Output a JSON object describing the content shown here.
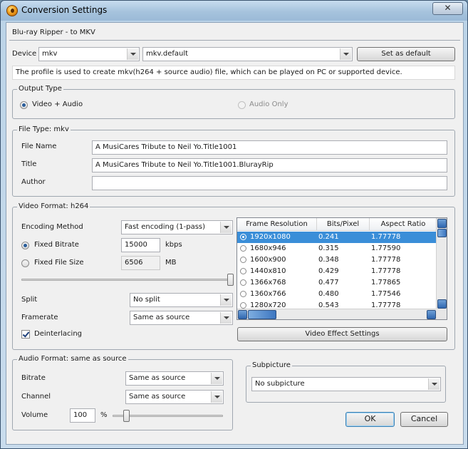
{
  "window": {
    "title": "Conversion Settings",
    "close_glyph": "✕"
  },
  "header": {
    "subtitle": "Blu-ray Ripper - to MKV"
  },
  "device": {
    "label": "Device",
    "value": "mkv",
    "profile": "mkv.default",
    "set_default_label": "Set as default",
    "description": "The profile is used to create mkv(h264 + source audio) file, which can be played on PC or supported device."
  },
  "output_type": {
    "legend": "Output Type",
    "options": [
      {
        "label": "Video + Audio",
        "selected": true,
        "enabled": true
      },
      {
        "label": "Audio Only",
        "selected": false,
        "enabled": false
      }
    ]
  },
  "file_type": {
    "legend": "File Type: mkv",
    "file_name_label": "File Name",
    "file_name_value": "A MusiCares Tribute to Neil Yo.Title1001",
    "title_label": "Title",
    "title_value": "A MusiCares Tribute to Neil Yo.Title1001.BlurayRip",
    "author_label": "Author",
    "author_value": ""
  },
  "video_format": {
    "legend": "Video Format: h264",
    "encoding_method_label": "Encoding Method",
    "encoding_method_value": "Fast encoding (1-pass)",
    "fixed_bitrate_label": "Fixed Bitrate",
    "fixed_bitrate_value": "15000",
    "fixed_bitrate_unit": "kbps",
    "fixed_bitrate_selected": true,
    "fixed_size_label": "Fixed File Size",
    "fixed_size_value": "6506",
    "fixed_size_unit": "MB",
    "fixed_size_selected": false,
    "quality_slider_level": 1.0,
    "split_label": "Split",
    "split_value": "No split",
    "framerate_label": "Framerate",
    "framerate_value": "Same as source",
    "deinterlacing_label": "Deinterlacing",
    "deinterlacing_checked": true,
    "effect_button_label": "Video Effect Settings",
    "resolution_table": {
      "columns": [
        "Frame Resolution",
        "Bits/Pixel",
        "Aspect Ratio"
      ],
      "rows": [
        {
          "resolution": "1920x1080",
          "bits": "0.241",
          "aspect": "1.77778",
          "selected": true
        },
        {
          "resolution": "1680x946",
          "bits": "0.315",
          "aspect": "1.77590",
          "selected": false
        },
        {
          "resolution": "1600x900",
          "bits": "0.348",
          "aspect": "1.77778",
          "selected": false
        },
        {
          "resolution": "1440x810",
          "bits": "0.429",
          "aspect": "1.77778",
          "selected": false
        },
        {
          "resolution": "1366x768",
          "bits": "0.477",
          "aspect": "1.77865",
          "selected": false
        },
        {
          "resolution": "1360x766",
          "bits": "0.480",
          "aspect": "1.77546",
          "selected": false
        },
        {
          "resolution": "1280x720",
          "bits": "0.543",
          "aspect": "1.77778",
          "selected": false
        }
      ]
    }
  },
  "audio_format": {
    "legend": "Audio Format: same as source",
    "bitrate_label": "Bitrate",
    "bitrate_value": "Same as source",
    "channel_label": "Channel",
    "channel_value": "Same as source",
    "volume_label": "Volume",
    "volume_value": "100",
    "volume_unit": "%",
    "volume_slider_level": 0.1
  },
  "subpicture": {
    "legend": "Subpicture",
    "value": "No subpicture"
  },
  "footer": {
    "ok_label": "OK",
    "cancel_label": "Cancel"
  },
  "colors": {
    "selection": "#3a8ed8",
    "title_bar": "#a6c3dd",
    "dialog_bg": "#f0f0f0"
  }
}
